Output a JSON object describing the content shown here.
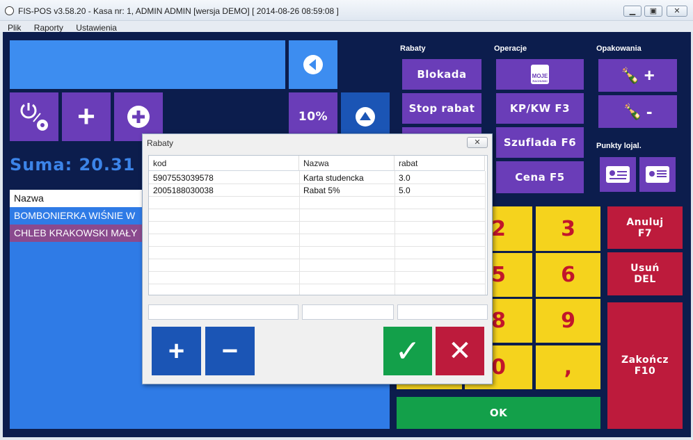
{
  "window": {
    "title": "FIS-POS v3.58.20 - Kasa nr: 1, ADMIN ADMIN [wersja DEMO]  [ 2014-08-26 08:59:08 ]",
    "minimize": "▁",
    "maximize": "▣",
    "close": "✕"
  },
  "menu": [
    "Plik",
    "Raporty",
    "Ustawienia"
  ],
  "left": {
    "sum_label": "Suma: 20.31",
    "list_header": "Nazwa",
    "items": [
      {
        "name": "BOMBONIERKA WIŚNIE W",
        "color": "#2f7be6"
      },
      {
        "name": "CHLEB KRAKOWSKI MAŁY",
        "color": "#8a4a8e"
      }
    ],
    "percent_button": "10%"
  },
  "sections": {
    "rabaty": "Rabaty",
    "operacje": "Operacje",
    "opakowania": "Opakowania",
    "punkty": "Punkty lojal."
  },
  "rabaty_buttons": [
    "Blokada",
    "Stop rabat"
  ],
  "operacje_buttons": {
    "logo_line1": "MOJE",
    "logo_line2": "RACHUNKI",
    "kpkw": "KP/KW F3",
    "szuflada": "Szuflada F6",
    "cena": "Cena F5"
  },
  "opakowania_buttons": {
    "plus": "+",
    "minus": "-"
  },
  "keypad": {
    "keys": [
      "2",
      "3",
      "5",
      "6",
      "8",
      "9",
      "0",
      ","
    ],
    "anuluj": [
      "Anuluj",
      "F7"
    ],
    "usun": [
      "Usuń",
      "DEL"
    ],
    "zakoncz": [
      "Zakończ",
      "F10"
    ],
    "ok": "OK"
  },
  "dialog": {
    "title": "Rabaty",
    "close": "✕",
    "columns": [
      "kod",
      "Nazwa",
      "rabat"
    ],
    "rows": [
      [
        "5907553039578",
        "Karta studencka",
        "3.0"
      ],
      [
        "2005188030038",
        "Rabat 5%",
        "5.0"
      ]
    ],
    "add": "+",
    "remove": "−",
    "confirm": "✓",
    "cancel": "✕"
  },
  "colors": {
    "background": "#0c1d4d",
    "purple": "#6a3db8",
    "blue": "#2f7be6",
    "yellow": "#f5d31d",
    "red": "#bd1b3c",
    "green": "#13a04a"
  }
}
